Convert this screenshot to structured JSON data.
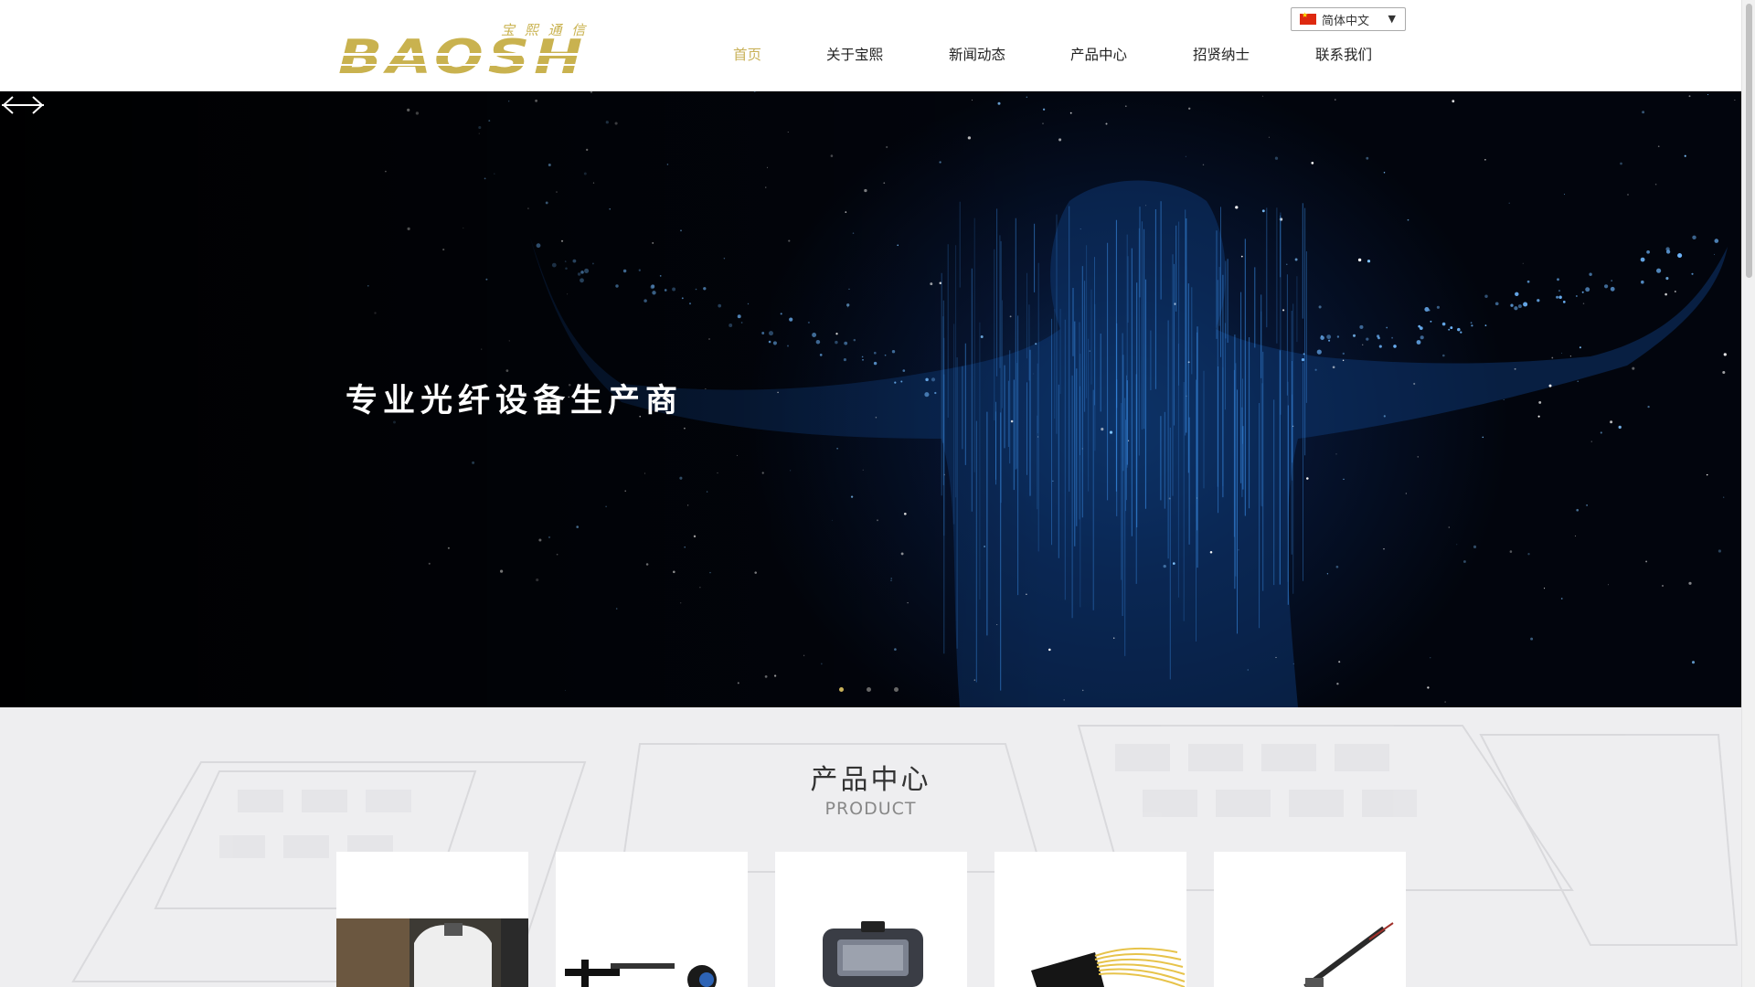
{
  "header": {
    "logo_text": "BAOSH",
    "logo_sub": "宝 熙 通 信",
    "language": "简体中文",
    "nav": [
      {
        "label": "首页",
        "active": true
      },
      {
        "label": "关于宝熙",
        "active": false
      },
      {
        "label": "新闻动态",
        "active": false
      },
      {
        "label": "产品中心",
        "active": false
      },
      {
        "label": "招贤纳士",
        "active": false
      },
      {
        "label": "联系我们",
        "active": false
      }
    ]
  },
  "banner": {
    "caption": "专业光纤设备生产商",
    "slides": 3,
    "active_slide": 1
  },
  "products": {
    "title": "产品中心",
    "subtitle": "PRODUCT",
    "cards": [
      {
        "icon": "microscope-icon"
      },
      {
        "icon": "fiber-fixture-icon"
      },
      {
        "icon": "handheld-meter-icon"
      },
      {
        "icon": "plc-splitter-icon"
      },
      {
        "icon": "fiber-probe-icon"
      }
    ]
  },
  "colors": {
    "accent": "#c9b25a",
    "logo_gold": "#c9b24f",
    "banner_dark": "#02050d",
    "banner_blue": "#2a8cff"
  }
}
